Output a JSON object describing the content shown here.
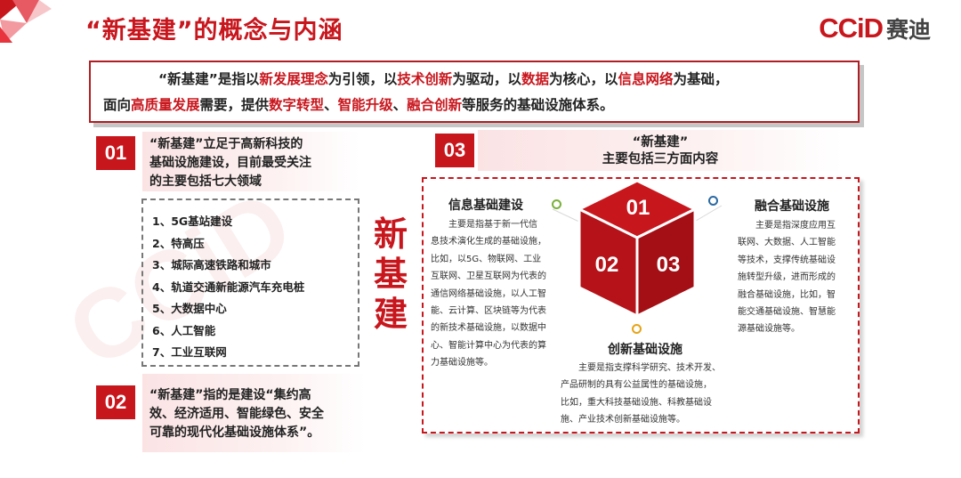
{
  "title": "“新基建”的概念与内涵",
  "logo": {
    "latin": "CCiD",
    "cn": "赛迪",
    "watermark": "CCiD"
  },
  "colors": {
    "accent": "#c8161d",
    "dot_green": "#7ab13a",
    "dot_blue": "#2b6aa3",
    "dot_orange": "#e6a417"
  },
  "definition": {
    "line1": [
      {
        "t": "“新基建”是指以",
        "hl": false
      },
      {
        "t": "新发展理念",
        "hl": true
      },
      {
        "t": "为引领，以",
        "hl": false
      },
      {
        "t": "技术创新",
        "hl": true
      },
      {
        "t": "为驱动，以",
        "hl": false
      },
      {
        "t": "数据",
        "hl": true
      },
      {
        "t": "为核心，以",
        "hl": false
      },
      {
        "t": "信息网络",
        "hl": true
      },
      {
        "t": "为基础，",
        "hl": false
      }
    ],
    "line2": [
      {
        "t": "面向",
        "hl": false
      },
      {
        "t": "高质量发展",
        "hl": true
      },
      {
        "t": "需要，提供",
        "hl": false
      },
      {
        "t": "数字转型",
        "hl": true
      },
      {
        "t": "、",
        "hl": false
      },
      {
        "t": "智能升级",
        "hl": true
      },
      {
        "t": "、",
        "hl": false
      },
      {
        "t": "融合创新",
        "hl": true
      },
      {
        "t": "等服务的基础设施体系。",
        "hl": false
      }
    ]
  },
  "section01": {
    "badge": "01",
    "lines": [
      "“新基建”立足于高新科技的",
      "基础设施建设，目前最受关注",
      "的主要包括七大领域"
    ],
    "items": [
      "1、5G基站建设",
      "2、特高压",
      "3、城际高速铁路和城市",
      "4、轨道交通新能源汽车充电桩",
      "5、大数据中心",
      "6、人工智能",
      "7、工业互联网"
    ]
  },
  "section02": {
    "badge": "02",
    "lines": [
      "“新基建”指的是建设“集约高",
      "效、经济适用、智能绿色、安全",
      "可靠的现代化基础设施体系”。"
    ]
  },
  "center_chars": [
    "新",
    "基",
    "建"
  ],
  "section03": {
    "badge": "03",
    "lines": [
      "“新基建”",
      "主要包括三方面内容"
    ],
    "cube_labels": [
      "01",
      "02",
      "03"
    ],
    "info": {
      "title": "信息基础建设",
      "lines": [
        "主要是指基于新一代信",
        "息技术演化生成的基础设施，",
        "比如，以5G、物联网、工业",
        "互联网、卫星互联网为代表的",
        "通信网络基础设施，以人工智",
        "能、云计算、区块链等为代表",
        "的新技术基础设施，以数据中",
        "心、智能计算中心为代表的算",
        "力基础设施等。"
      ]
    },
    "fusion": {
      "title": "融合基础设施",
      "lines": [
        "主要是指深度应用互",
        "联网、大数据、人工智能",
        "等技术，支撑传统基础设",
        "施转型升级，进而形成的",
        "融合基础设施，比如，智",
        "能交通基础设施、智慧能",
        "源基础设施等。"
      ]
    },
    "innovation": {
      "title": "创新基础设施",
      "lines": [
        "主要是指支撑科学研究、技术开发、",
        "产品研制的具有公益属性的基础设施，",
        "比如，重大科技基础设施、科教基础设",
        "施、产业技术创新基础设施等。"
      ]
    }
  }
}
